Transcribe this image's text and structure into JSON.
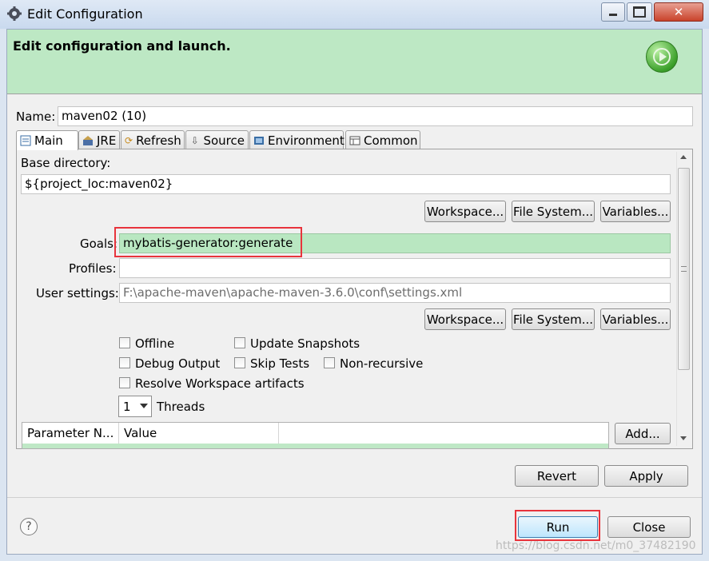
{
  "window": {
    "title": "Edit Configuration",
    "icons": {
      "app": "gear-icon",
      "minimize": "minimize-icon",
      "maximize": "maximize-icon",
      "close": "close-icon"
    }
  },
  "banner": {
    "title": "Edit configuration and launch.",
    "logo": "run-launch-icon"
  },
  "name": {
    "label": "Name:",
    "value": "maven02 (10)"
  },
  "tabs": [
    {
      "label": "Main",
      "icon": "main-tab-icon",
      "active": true
    },
    {
      "label": "JRE",
      "icon": "jre-icon"
    },
    {
      "label": "Refresh",
      "icon": "refresh-icon"
    },
    {
      "label": "Source",
      "icon": "source-icon"
    },
    {
      "label": "Environment",
      "icon": "environment-icon"
    },
    {
      "label": "Common",
      "icon": "common-icon"
    }
  ],
  "main": {
    "base_dir_label": "Base directory:",
    "base_dir_value": "${project_loc:maven02}",
    "buttons1": {
      "workspace": "Workspace...",
      "filesystem": "File System...",
      "variables": "Variables..."
    },
    "goals_label": "Goals:",
    "goals_value": "mybatis-generator:generate",
    "profiles_label": "Profiles:",
    "profiles_value": "",
    "user_settings_label": "User settings:",
    "user_settings_value": "F:\\apache-maven\\apache-maven-3.6.0\\conf\\settings.xml",
    "buttons2": {
      "workspace": "Workspace...",
      "filesystem": "File System...",
      "variables": "Variables..."
    },
    "options": {
      "offline": {
        "label": "Offline",
        "checked": false
      },
      "update_snapshots": {
        "label": "Update Snapshots",
        "checked": false
      },
      "debug_output": {
        "label": "Debug Output",
        "checked": false
      },
      "skip_tests": {
        "label": "Skip Tests",
        "checked": false
      },
      "non_recursive": {
        "label": "Non-recursive",
        "checked": false
      },
      "resolve_workspace": {
        "label": "Resolve Workspace artifacts",
        "checked": false
      }
    },
    "threads": {
      "value": "1",
      "label": "Threads"
    },
    "param_table": {
      "columns": [
        "Parameter N...",
        "Value"
      ],
      "add_label": "Add..."
    }
  },
  "footer": {
    "revert": "Revert",
    "apply": "Apply",
    "run": "Run",
    "close": "Close",
    "help_icon": "help-icon",
    "watermark": "https://blog.csdn.net/m0_37482190"
  },
  "colors": {
    "banner": "#bde8c4",
    "goals_highlight": "#b9e7c1",
    "annotation_box": "#e8343c"
  }
}
